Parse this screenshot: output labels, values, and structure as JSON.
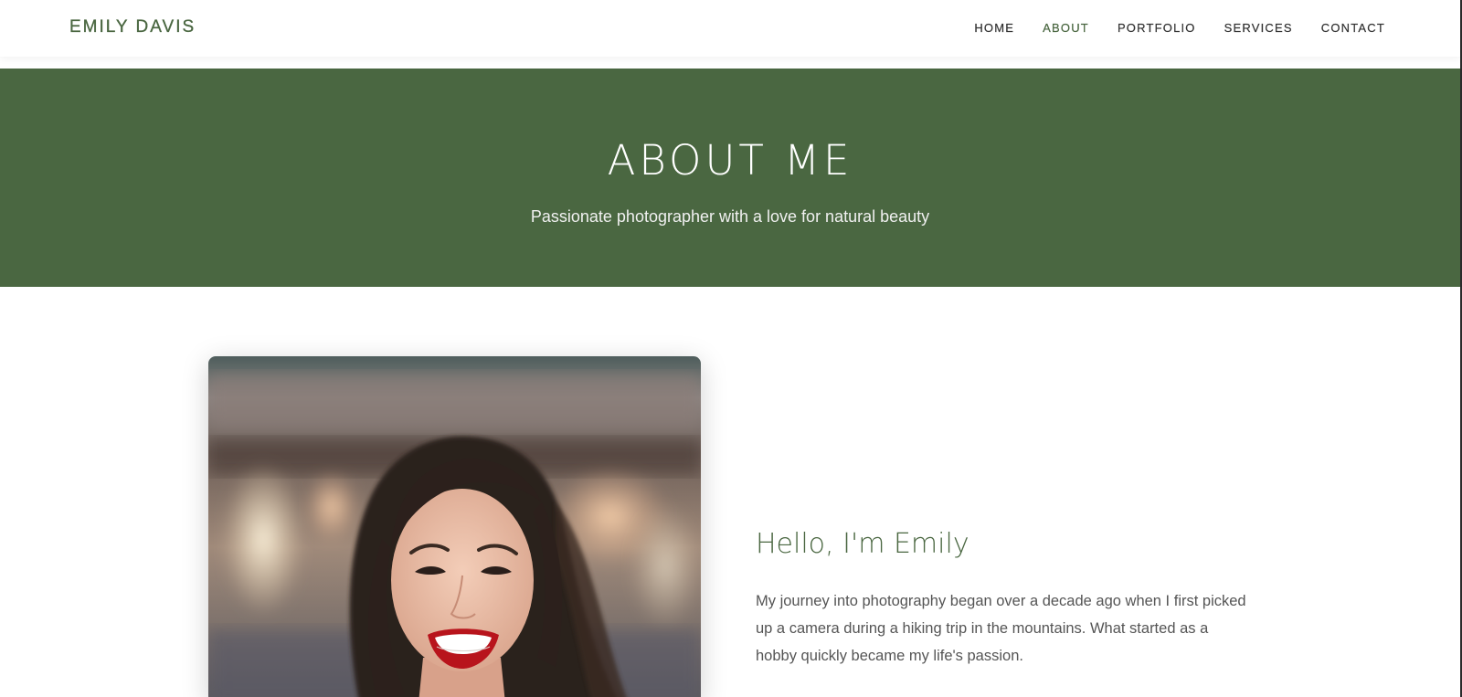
{
  "brand": {
    "name": "EMILY DAVIS"
  },
  "nav": {
    "items": [
      {
        "label": "HOME",
        "active": false
      },
      {
        "label": "ABOUT",
        "active": true
      },
      {
        "label": "PORTFOLIO",
        "active": false
      },
      {
        "label": "SERVICES",
        "active": false
      },
      {
        "label": "CONTACT",
        "active": false
      }
    ]
  },
  "hero": {
    "title": "ABOUT ME",
    "subtitle": "Passionate photographer with a love for natural beauty"
  },
  "about": {
    "photo_alt": "Portrait of Emily",
    "heading": "Hello, I'm Emily",
    "paragraph": "My journey into photography began over a decade ago when I first picked up a camera during a hiking trip in the mountains. What started as a hobby quickly became my life's passion."
  },
  "colors": {
    "accent": "#4a6741",
    "text": "#333333",
    "muted_text": "#555555",
    "background": "#ffffff"
  }
}
